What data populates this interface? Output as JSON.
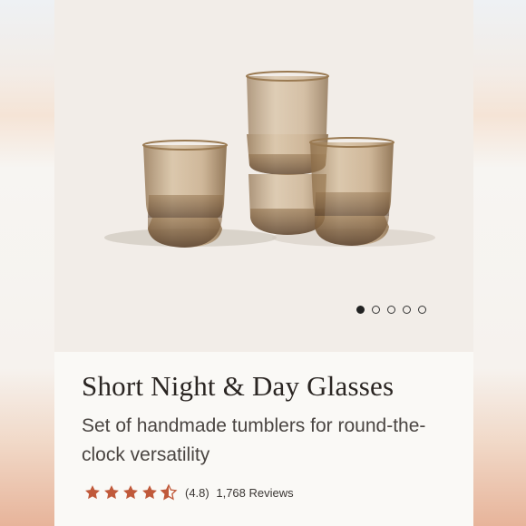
{
  "product": {
    "title": "Short Night & Day Glasses",
    "subtitle": "Set of handmade tumblers for round-the-clock versatility",
    "rating_value": "(4.8)",
    "review_count": "1,768 Reviews",
    "rating": 4.8,
    "star_color": "#c0593a"
  },
  "carousel": {
    "slides": 5,
    "active_index": 0
  },
  "colors": {
    "glass": "#b08c5d",
    "glass_dark": "#6b4a2a",
    "card_bg": "#faf9f6",
    "photo_bg": "#f2ede8"
  }
}
